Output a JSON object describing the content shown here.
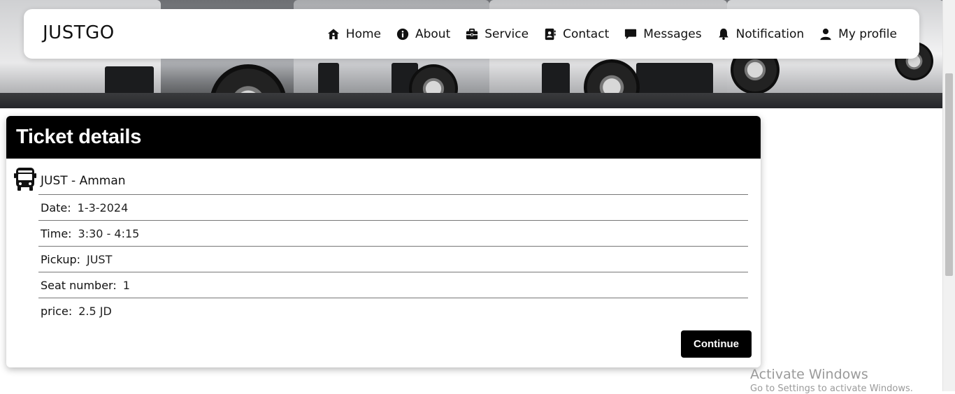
{
  "brand": "JUSTGO",
  "nav": {
    "home": "Home",
    "about": "About",
    "service": "Service",
    "contact": "Contact",
    "messages": "Messages",
    "notification": "Notification",
    "profile": "My profile"
  },
  "ticket": {
    "title": "Ticket details",
    "route": "JUST - Amman",
    "date_label": "Date:",
    "date": "1-3-2024",
    "time_label": "Time:",
    "time": "3:30 - 4:15",
    "pickup_label": "Pickup:",
    "pickup": "JUST",
    "seat_label": "Seat number:",
    "seat": "1",
    "price_label": "price:",
    "price": "2.5 JD",
    "continue": "Continue"
  },
  "watermark": {
    "line1": "Activate Windows",
    "line2": "Go to Settings to activate Windows."
  },
  "icons": [
    "home-icon",
    "info-icon",
    "briefcase-icon",
    "contact-card-icon",
    "message-icon",
    "bell-icon",
    "user-icon",
    "bus-icon"
  ]
}
